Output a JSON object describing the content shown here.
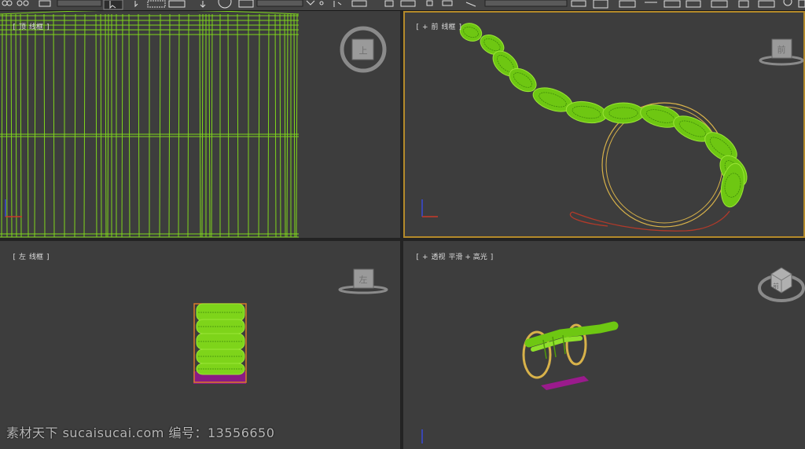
{
  "toolbar": {
    "icons": [
      "link-icon",
      "unlink-icon",
      "bind-icon",
      "select-icon",
      "select-region-icon",
      "window-crossing-icon",
      "move-icon",
      "rotate-icon",
      "scale-icon",
      "snap-icon",
      "mirror-icon",
      "align-icon",
      "layer-icon",
      "curve-editor-icon",
      "schematic-icon",
      "material-editor-icon",
      "render-setup-icon",
      "render-frame-icon",
      "render-icon"
    ]
  },
  "viewports": {
    "top": {
      "label_parts": [
        "[",
        "顶",
        "线框",
        "]"
      ],
      "gizmo_label": "上"
    },
    "front": {
      "label_parts": [
        "[",
        "+",
        "前",
        "线框",
        "]"
      ],
      "gizmo_label": "前"
    },
    "left": {
      "label_parts": [
        "[",
        "左",
        "线框",
        "]"
      ],
      "gizmo_label": "左"
    },
    "perspective": {
      "label_parts": [
        "[",
        "+",
        "透视",
        "平滑 + 高光",
        "]"
      ],
      "gizmo_label": "前"
    }
  },
  "watermark": "素材天下 sucaisucai.com  编号：13556650",
  "colors": {
    "viewport_bg": "#3d3d3d",
    "wire_green": "#7fd61c",
    "frame_yellow": "#d8b24a",
    "rail_purple": "#9a1b8c",
    "active_border": "#b48a2a"
  }
}
